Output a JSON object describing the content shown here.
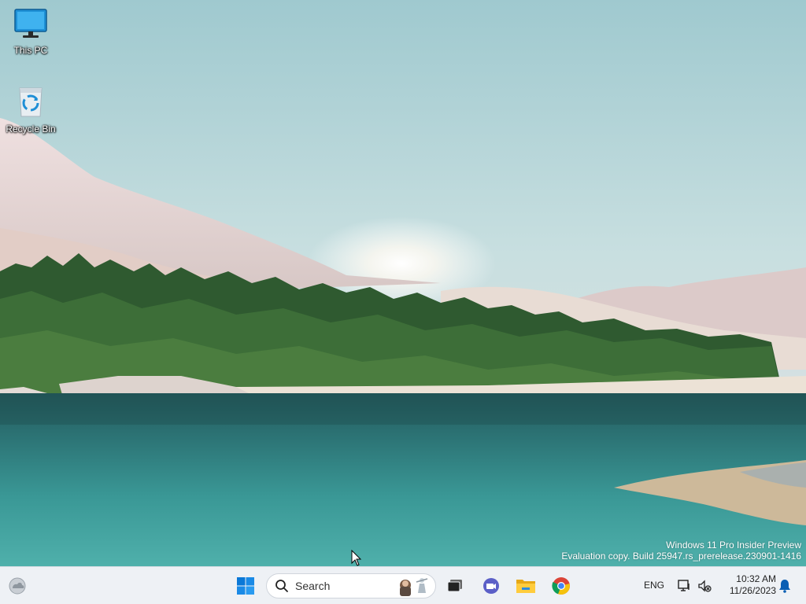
{
  "desktop": {
    "icons": [
      {
        "label": "This PC",
        "icon": "monitor-icon"
      },
      {
        "label": "Recycle Bin",
        "icon": "recycle-bin-icon"
      }
    ],
    "watermark": {
      "line1": "Windows 11 Pro Insider Preview",
      "line2": "Evaluation copy. Build 25947.rs_prerelease.230901-1416"
    }
  },
  "taskbar": {
    "search": {
      "placeholder": "Search"
    },
    "pinned": [
      {
        "name": "start-button",
        "icon": "windows-logo-icon"
      },
      {
        "name": "task-view-button",
        "icon": "task-view-icon"
      },
      {
        "name": "teams-chat-button",
        "icon": "chat-icon"
      },
      {
        "name": "file-explorer-button",
        "icon": "folder-icon"
      },
      {
        "name": "chrome-button",
        "icon": "chrome-icon"
      }
    ],
    "tray": {
      "language": "ENG",
      "time": "10:32 AM",
      "date": "11/26/2023"
    }
  },
  "colors": {
    "taskbar_bg": "#eef1f5",
    "windows_blue": "#0a78d7",
    "sky": "#b7d7dc",
    "lake": "#2f8a8c"
  }
}
